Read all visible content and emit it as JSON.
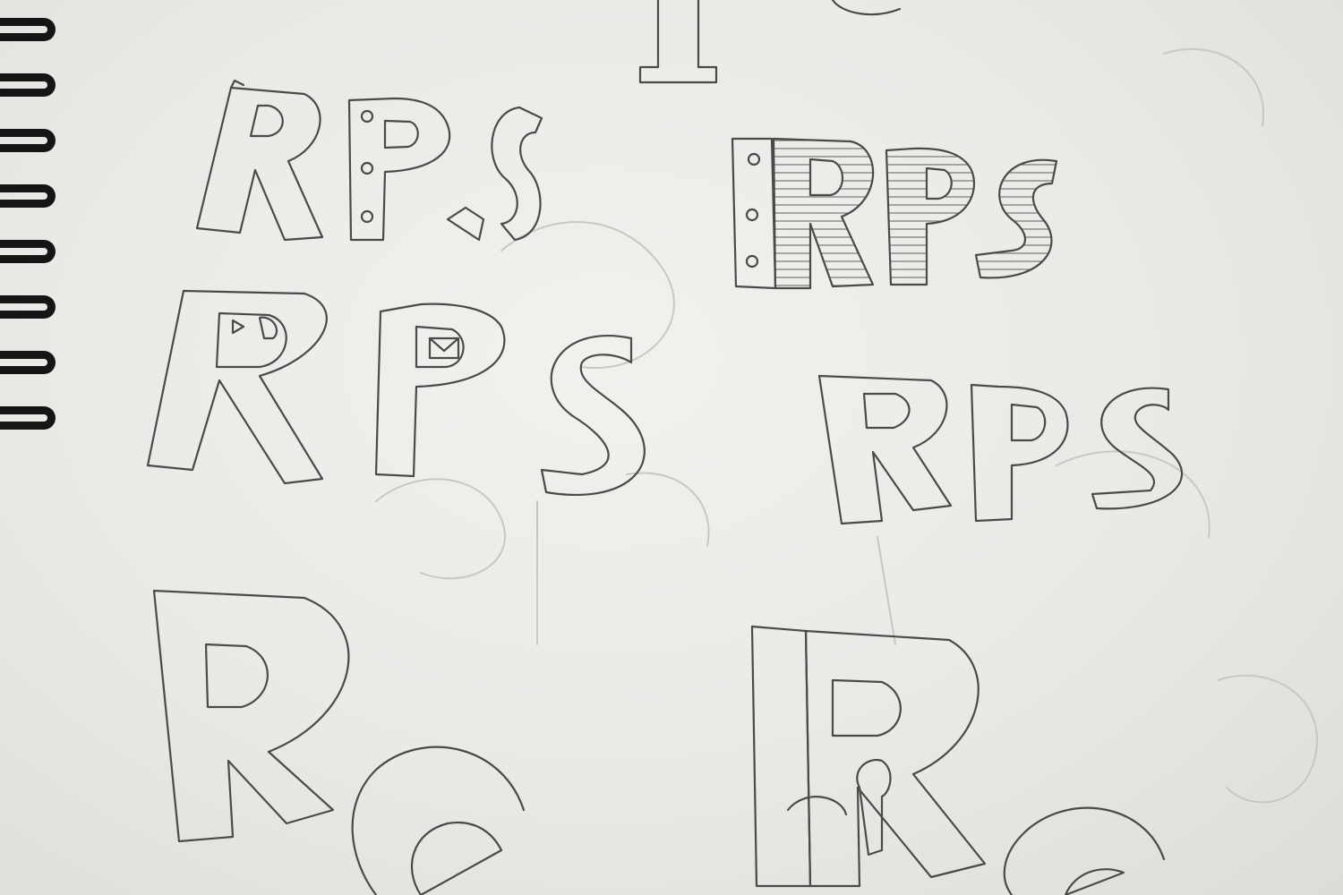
{
  "sketch_groups": [
    {
      "id": "top-left",
      "letters": [
        "R",
        "P",
        "S"
      ]
    },
    {
      "id": "top-right",
      "letters": [
        "R",
        "P",
        "S"
      ]
    },
    {
      "id": "mid-left",
      "letters": [
        "R",
        "P",
        "S"
      ]
    },
    {
      "id": "mid-right",
      "letters": [
        "R",
        "P",
        "S"
      ]
    },
    {
      "id": "bottom-left",
      "letters": [
        "R",
        "S"
      ]
    },
    {
      "id": "bottom-right",
      "letters": [
        "R",
        "S"
      ]
    }
  ],
  "colors": {
    "paper": "#efedea",
    "pencil": "#4a4a4a",
    "binding": "#151515"
  }
}
